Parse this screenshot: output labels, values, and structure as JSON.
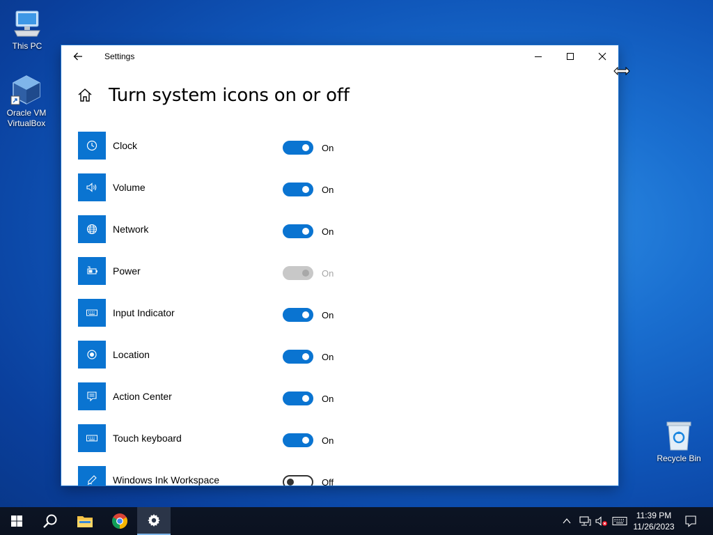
{
  "desktop": {
    "icons": [
      {
        "label": "This PC",
        "icon": "computer-icon"
      },
      {
        "label_line1": "Oracle VM",
        "label_line2": "VirtualBox",
        "icon": "virtualbox-icon"
      },
      {
        "label": "Recycle Bin",
        "icon": "recycle-bin-icon"
      }
    ]
  },
  "window": {
    "title": "Settings",
    "page_title": "Turn system icons on or off",
    "accent": "#0a74d1",
    "items": [
      {
        "label": "Clock",
        "state": "On",
        "enabled": true,
        "on": true,
        "icon": "clock-icon"
      },
      {
        "label": "Volume",
        "state": "On",
        "enabled": true,
        "on": true,
        "icon": "volume-icon"
      },
      {
        "label": "Network",
        "state": "On",
        "enabled": true,
        "on": true,
        "icon": "globe-icon"
      },
      {
        "label": "Power",
        "state": "On",
        "enabled": false,
        "on": true,
        "icon": "battery-icon"
      },
      {
        "label": "Input Indicator",
        "state": "On",
        "enabled": true,
        "on": true,
        "icon": "keyboard-icon"
      },
      {
        "label": "Location",
        "state": "On",
        "enabled": true,
        "on": true,
        "icon": "location-icon"
      },
      {
        "label": "Action Center",
        "state": "On",
        "enabled": true,
        "on": true,
        "icon": "action-center-icon"
      },
      {
        "label": "Touch keyboard",
        "state": "On",
        "enabled": true,
        "on": true,
        "icon": "touch-keyboard-icon"
      },
      {
        "label": "Windows Ink Workspace",
        "state": "Off",
        "enabled": true,
        "on": false,
        "icon": "pen-icon"
      }
    ]
  },
  "taskbar": {
    "time": "11:39 PM",
    "date": "11/26/2023",
    "apps": [
      "start-icon",
      "search-icon",
      "file-explorer-icon",
      "chrome-icon",
      "settings-gear-icon"
    ]
  }
}
